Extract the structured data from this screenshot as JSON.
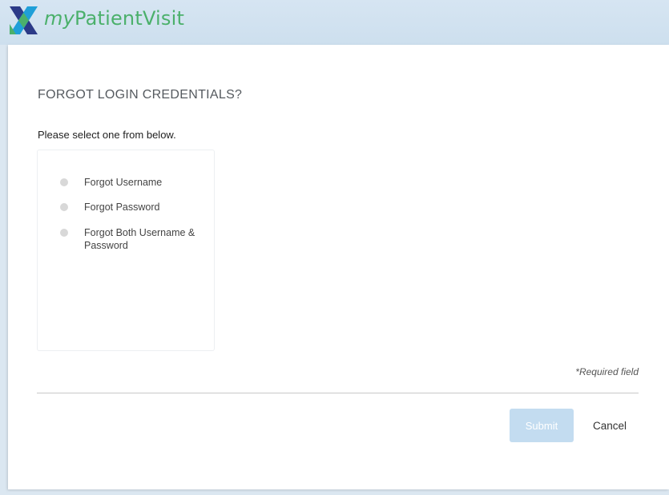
{
  "header": {
    "logo_prefix": "my",
    "logo_suffix": "PatientVisit",
    "brand_color": "#4bb06b"
  },
  "form": {
    "title": "FORGOT LOGIN CREDENTIALS?",
    "subtitle": "Please select one from below.",
    "options": [
      {
        "label": "Forgot Username",
        "selected": false
      },
      {
        "label": "Forgot Password",
        "selected": false
      },
      {
        "label": "Forgot Both Username & Password",
        "selected": false
      }
    ],
    "required_note": "*Required field"
  },
  "actions": {
    "submit_label": "Submit",
    "cancel_label": "Cancel",
    "submit_color": "#c3dcf0"
  }
}
